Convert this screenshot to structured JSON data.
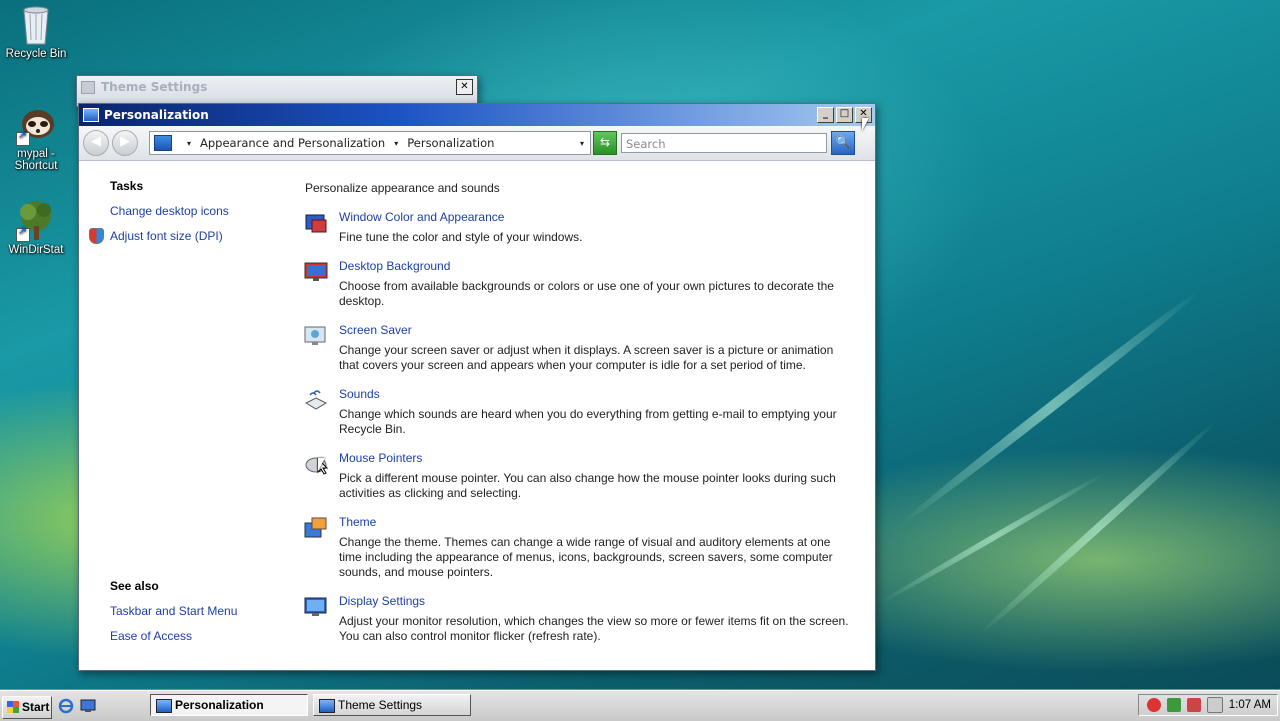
{
  "desktop": {
    "icons": [
      {
        "label": "Recycle Bin"
      },
      {
        "label": "mypal - Shortcut"
      },
      {
        "label": "WinDirStat"
      }
    ]
  },
  "theme_window": {
    "title": "Theme Settings",
    "close": "✕"
  },
  "personalization_window": {
    "title": "Personalization",
    "buttons": {
      "minimize": "_",
      "maximize": "□",
      "close": "✕"
    },
    "nav": {
      "back": "◀",
      "forward": "▶",
      "breadcrumb": [
        "Appearance and Personalization",
        "Personalization"
      ],
      "breadcrumb_sep": "▾",
      "search_placeholder": "Search",
      "go": "⇆",
      "search_btn": "🔍"
    },
    "tasks": {
      "heading": "Tasks",
      "links": [
        "Change desktop icons",
        "Adjust font size (DPI)"
      ]
    },
    "see_also": {
      "heading": "See also",
      "links": [
        "Taskbar and Start Menu",
        "Ease of Access"
      ]
    },
    "main": {
      "title": "Personalize appearance and sounds",
      "items": [
        {
          "label": "Window Color and Appearance",
          "desc": "Fine tune the color and style of your windows.",
          "icon": "window-color-icon"
        },
        {
          "label": "Desktop Background",
          "desc": "Choose from available backgrounds or colors or use one of your own pictures to decorate the desktop.",
          "icon": "desktop-background-icon"
        },
        {
          "label": "Screen Saver",
          "desc": "Change your screen saver or adjust when it displays. A screen saver is a picture or animation that covers your screen and appears when your computer is idle for a set period of time.",
          "icon": "screen-saver-icon"
        },
        {
          "label": "Sounds",
          "desc": "Change which sounds are heard when you do everything from getting e-mail to emptying your Recycle Bin.",
          "icon": "sounds-icon"
        },
        {
          "label": "Mouse Pointers",
          "desc": "Pick a different mouse pointer. You can also change how the mouse pointer looks during such activities as clicking and selecting.",
          "icon": "mouse-pointers-icon"
        },
        {
          "label": "Theme",
          "desc": "Change the theme. Themes can change a wide range of visual and auditory elements at one time including the appearance of menus, icons, backgrounds, screen savers, some computer sounds, and mouse pointers.",
          "icon": "theme-icon"
        },
        {
          "label": "Display Settings",
          "desc": "Adjust your monitor resolution, which changes the view so more or fewer items fit on the screen. You can also control monitor flicker (refresh rate).",
          "icon": "display-settings-icon"
        }
      ]
    }
  },
  "taskbar": {
    "start": "Start",
    "buttons": [
      "Personalization",
      "Theme Settings"
    ],
    "clock": "1:07 AM"
  }
}
